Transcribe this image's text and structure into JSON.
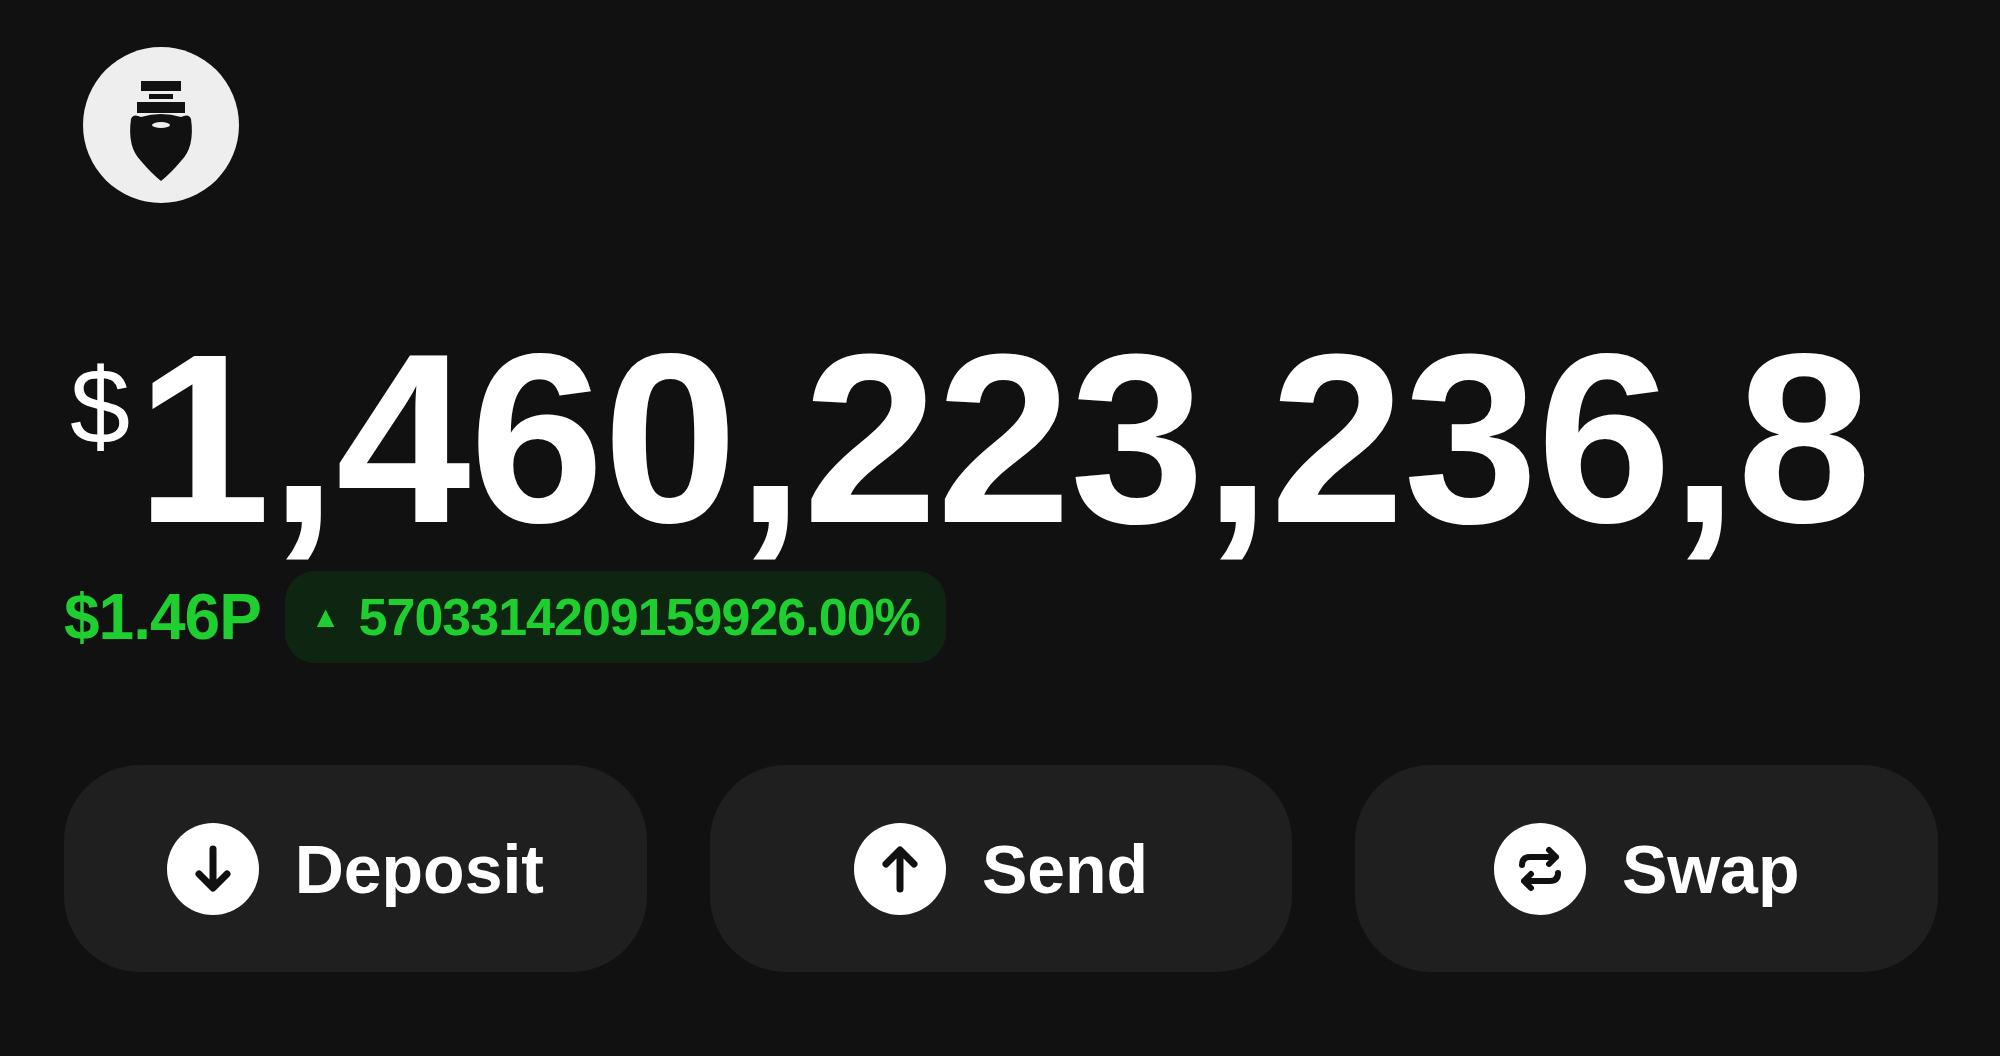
{
  "balance": {
    "currency": "$",
    "amount": "1,460,223,236,8"
  },
  "change": {
    "value": "$1.46P",
    "arrow": "▲",
    "percent": "5703314209159926.00%"
  },
  "actions": [
    {
      "kind": "deposit",
      "label": "Deposit"
    },
    {
      "kind": "send",
      "label": "Send"
    },
    {
      "kind": "swap",
      "label": "Swap"
    }
  ]
}
